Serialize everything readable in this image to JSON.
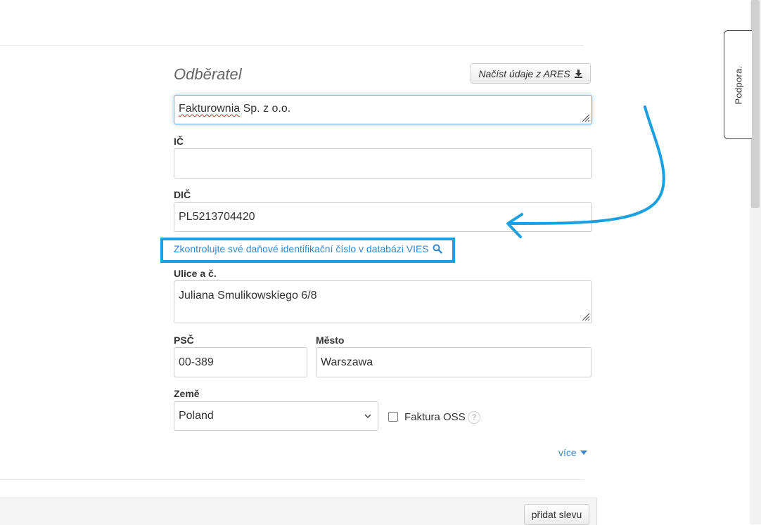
{
  "customer": {
    "section_title": "Odběratel",
    "ares_button_label": "Načíst údaje z ARES",
    "name_value_misspelled": "Fakturownia",
    "name_value_rest": " Sp. z o.o.",
    "ic_label": "IČ",
    "ic_value": "",
    "dic_label": "DIČ",
    "dic_value": "PL5213704420",
    "vies_link": "Zkontrolujte své daňové identifikační číslo v databázi VIES",
    "street_label": "Ulice a č.",
    "street_value": "Juliana Smulikowskiego 6/8",
    "postal_label": "PSČ",
    "postal_value": "00-389",
    "city_label": "Město",
    "city_value": "Warszawa",
    "country_label": "Země",
    "country_value": "Poland",
    "oss_label": "Faktura OSS",
    "help_glyph": "?",
    "more_link": "více"
  },
  "footer": {
    "discount_button": "přidat slevu"
  },
  "support": {
    "label": "Podpora."
  },
  "colors": {
    "annotation": "#1aa0e0",
    "link": "#3a87c9",
    "focus": "#66afe9"
  },
  "icons": [
    "download-icon",
    "search-icon",
    "chevron-down-icon",
    "caret-down-icon",
    "question-icon",
    "resize-grip-icon",
    "annotation-arrow"
  ]
}
